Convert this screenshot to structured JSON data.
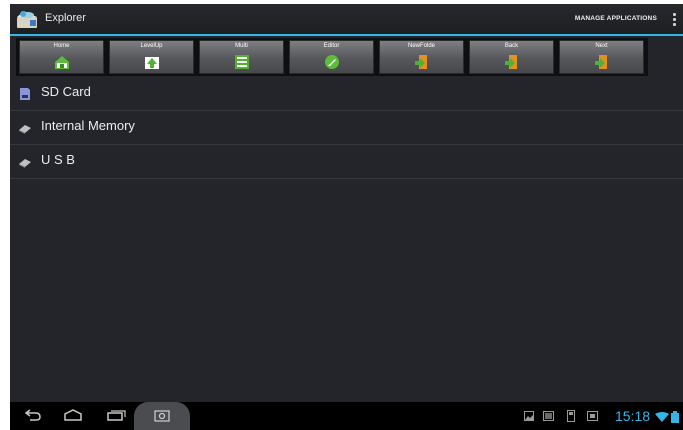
{
  "actionbar": {
    "title": "Explorer",
    "manage_label": "MANAGE APPLICATIONS"
  },
  "toolbar": {
    "buttons": [
      {
        "label": "Home",
        "icon": "home-icon"
      },
      {
        "label": "LevelUp",
        "icon": "levelup-icon"
      },
      {
        "label": "Multi",
        "icon": "multi-icon"
      },
      {
        "label": "Editor",
        "icon": "editor-icon"
      },
      {
        "label": "NewFolde",
        "icon": "new-folder-icon"
      },
      {
        "label": "Back",
        "icon": "back-icon"
      },
      {
        "label": "Next",
        "icon": "next-icon"
      }
    ]
  },
  "storage": {
    "items": [
      {
        "label": "SD Card",
        "icon": "sd-card-icon"
      },
      {
        "label": "Internal Memory",
        "icon": "drive-icon"
      },
      {
        "label": "U S B",
        "icon": "drive-icon"
      }
    ]
  },
  "status": {
    "time": "15:18"
  },
  "colors": {
    "accent": "#33b5e5",
    "background": "#23252a",
    "toolbar_button": "#5f6165"
  }
}
